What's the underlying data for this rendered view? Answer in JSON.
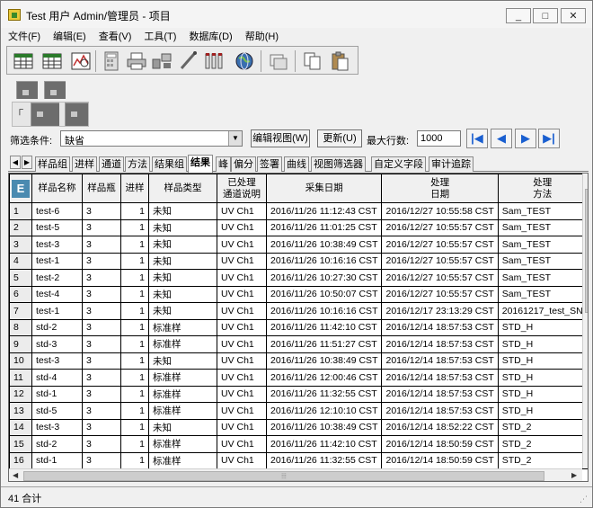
{
  "window": {
    "title": "Test 用户 Admin/管理员 - 项目",
    "controls": [
      "_",
      "□",
      "✕"
    ]
  },
  "menu": [
    "文件(F)",
    "编辑(E)",
    "查看(V)",
    "工具(T)",
    "数据库(D)",
    "帮助(H)"
  ],
  "filter": {
    "label": "筛选条件:",
    "value": "缺省",
    "edit_view_label": "编辑视图(W)",
    "refresh_label": "更新(U)",
    "max_rows_label": "最大行数:",
    "max_rows_value": "1000"
  },
  "tabs": [
    "样品组",
    "进样",
    "通道",
    "方法",
    "结果组",
    "结果",
    "峰",
    "偏分",
    "签署",
    "曲线",
    "视图筛选器",
    "自定义字段",
    "审计追踪"
  ],
  "active_tab": "结果",
  "table": {
    "corner_icon": "E",
    "headers": [
      "",
      "样品名称",
      "样品瓶",
      "进样",
      "样品类型",
      "已处理\n通道说明",
      "采集日期",
      "处理\n日期",
      "处理\n方法"
    ],
    "rows": [
      [
        "1",
        "test-6",
        "3",
        "1",
        "未知",
        "UV Ch1",
        "2016/11/26 11:12:43 CST",
        "2016/12/27 10:55:58 CST",
        "Sam_TEST"
      ],
      [
        "2",
        "test-5",
        "3",
        "1",
        "未知",
        "UV Ch1",
        "2016/11/26 11:01:25 CST",
        "2016/12/27 10:55:57 CST",
        "Sam_TEST"
      ],
      [
        "3",
        "test-3",
        "3",
        "1",
        "未知",
        "UV Ch1",
        "2016/11/26 10:38:49 CST",
        "2016/12/27 10:55:57 CST",
        "Sam_TEST"
      ],
      [
        "4",
        "test-1",
        "3",
        "1",
        "未知",
        "UV Ch1",
        "2016/11/26 10:16:16 CST",
        "2016/12/27 10:55:57 CST",
        "Sam_TEST"
      ],
      [
        "5",
        "test-2",
        "3",
        "1",
        "未知",
        "UV Ch1",
        "2016/11/26 10:27:30 CST",
        "2016/12/27 10:55:57 CST",
        "Sam_TEST"
      ],
      [
        "6",
        "test-4",
        "3",
        "1",
        "未知",
        "UV Ch1",
        "2016/11/26 10:50:07 CST",
        "2016/12/27 10:55:57 CST",
        "Sam_TEST"
      ],
      [
        "7",
        "test-1",
        "3",
        "1",
        "未知",
        "UV Ch1",
        "2016/11/26 10:16:16 CST",
        "2016/12/17 23:13:29 CST",
        "20161217_test_SN"
      ],
      [
        "8",
        "std-2",
        "3",
        "1",
        "标准样",
        "UV Ch1",
        "2016/11/26 11:42:10 CST",
        "2016/12/14 18:57:53 CST",
        "STD_H"
      ],
      [
        "9",
        "std-3",
        "3",
        "1",
        "标准样",
        "UV Ch1",
        "2016/11/26 11:51:27 CST",
        "2016/12/14 18:57:53 CST",
        "STD_H"
      ],
      [
        "10",
        "test-3",
        "3",
        "1",
        "未知",
        "UV Ch1",
        "2016/11/26 10:38:49 CST",
        "2016/12/14 18:57:53 CST",
        "STD_H"
      ],
      [
        "11",
        "std-4",
        "3",
        "1",
        "标准样",
        "UV Ch1",
        "2016/11/26 12:00:46 CST",
        "2016/12/14 18:57:53 CST",
        "STD_H"
      ],
      [
        "12",
        "std-1",
        "3",
        "1",
        "标准样",
        "UV Ch1",
        "2016/11/26 11:32:55 CST",
        "2016/12/14 18:57:53 CST",
        "STD_H"
      ],
      [
        "13",
        "std-5",
        "3",
        "1",
        "标准样",
        "UV Ch1",
        "2016/11/26 12:10:10 CST",
        "2016/12/14 18:57:53 CST",
        "STD_H"
      ],
      [
        "14",
        "test-3",
        "3",
        "1",
        "未知",
        "UV Ch1",
        "2016/11/26 10:38:49 CST",
        "2016/12/14 18:52:22 CST",
        "STD_2"
      ],
      [
        "15",
        "std-2",
        "3",
        "1",
        "标准样",
        "UV Ch1",
        "2016/11/26 11:42:10 CST",
        "2016/12/14 18:50:59 CST",
        "STD_2"
      ],
      [
        "16",
        "std-1",
        "3",
        "1",
        "标准样",
        "UV Ch1",
        "2016/11/26 11:32:55 CST",
        "2016/12/14 18:50:59 CST",
        "STD_2"
      ]
    ]
  },
  "status": {
    "text": "41 合计"
  },
  "icons": {
    "toolbar": [
      "open-project-icon",
      "table-view-icon",
      "review-icon",
      "calculator-icon",
      "printer-icon",
      "network-icon",
      "pipette-icon",
      "vials-icon",
      "globe-icon",
      "window-icon",
      "copy-icon",
      "paste-icon"
    ]
  },
  "colors": {
    "nav_arrow": "#1a5fd0",
    "corner": "#4a8ab0"
  }
}
